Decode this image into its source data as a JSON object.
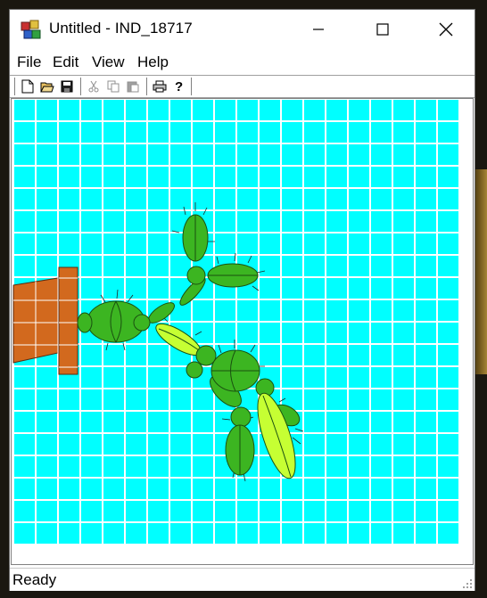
{
  "window": {
    "title": "Untitled - IND_18717"
  },
  "menu": {
    "items": [
      "File",
      "Edit",
      "View",
      "Help"
    ]
  },
  "toolbar": {
    "buttons": [
      "new-icon",
      "open-icon",
      "save-icon",
      "cut-icon",
      "copy-icon",
      "paste-icon",
      "print-icon",
      "help-icon"
    ]
  },
  "canvas": {
    "background_color": "#00ffff",
    "grid_color": "#ffffff",
    "pot_color": "#d2691e",
    "cactus_dark": "#3cb521",
    "cactus_light": "#c6ff33"
  },
  "status": {
    "text": "Ready"
  }
}
